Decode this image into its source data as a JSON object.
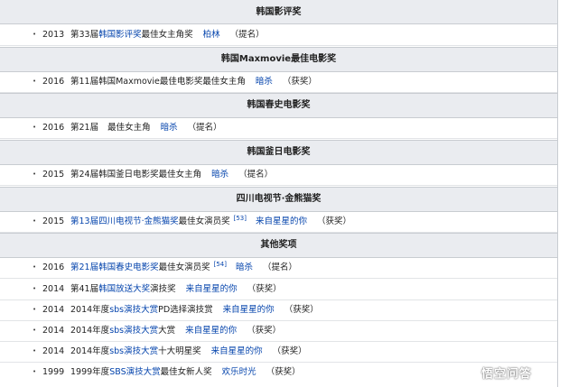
{
  "sections": {
    "s1": {
      "title": "韩国影评奖",
      "rows": [
        {
          "year": "2013",
          "a": "第33届",
          "b": "韩国影评奖",
          "c": "最佳女主角奖",
          "d": "柏林",
          "e": "（提名）"
        }
      ]
    },
    "s2": {
      "title": "韩国Maxmovie最佳电影奖",
      "rows": [
        {
          "year": "2016",
          "a": "第11届韩国Maxmovie最佳电影奖最佳女主角",
          "d": "暗杀",
          "e": "（获奖）"
        }
      ]
    },
    "s3": {
      "title": "韩国春史电影奖",
      "rows": [
        {
          "year": "2016",
          "a": "第21届",
          "c": "最佳女主角",
          "d": "暗杀",
          "e": "（提名）"
        }
      ]
    },
    "s4": {
      "title": "韩国釜日电影奖",
      "rows": [
        {
          "year": "2015",
          "a": "第24届韩国釜日电影奖最佳女主角",
          "d": "暗杀",
          "e": "（提名）"
        }
      ]
    },
    "s5": {
      "title": "四川电视节·金熊猫奖",
      "rows": [
        {
          "year": "2015",
          "b": "第13届四川电视节·金熊猫奖",
          "c": "最佳女演员奖",
          "ref": "[53]",
          "d": "来自星星的你",
          "e": "（获奖）"
        }
      ]
    },
    "s6": {
      "title": "其他奖项",
      "rows": [
        {
          "year": "2016",
          "b": "第21届韩国春史电影奖",
          "c": "最佳女演员奖",
          "ref": "[54]",
          "d": "暗杀",
          "e": "（提名）"
        },
        {
          "year": "2014",
          "a": "第41届",
          "b": "韩国放送大奖",
          "c": "演技奖",
          "d": "来自星星的你",
          "e": "（获奖）"
        },
        {
          "year": "2014",
          "a": "2014年度",
          "b": "sbs演技大赏",
          "c": "PD选择演技赏",
          "d": "来自星星的你",
          "e": "（获奖）"
        },
        {
          "year": "2014",
          "a": "2014年度",
          "b": "sbs演技大赏",
          "c": "大赏",
          "d": "来自星星的你",
          "e": "（获奖）"
        },
        {
          "year": "2014",
          "a": "2014年度",
          "b": "sbs演技大赏",
          "c": "十大明星奖",
          "d": "来自星星的你",
          "e": "（获奖）"
        },
        {
          "year": "1999",
          "a": "1999年度",
          "b": "SBS演技大赏",
          "c": "最佳女新人奖",
          "d": "欢乐时光",
          "e": "（获奖）"
        }
      ]
    }
  },
  "bullet_glyph": "•",
  "watermark": {
    "text": "悟空问答",
    "icon": "wukong-logo-icon"
  },
  "colors": {
    "link": "#0645ad",
    "header_bg": "#eaecf0",
    "border": "#c8ccd1"
  }
}
